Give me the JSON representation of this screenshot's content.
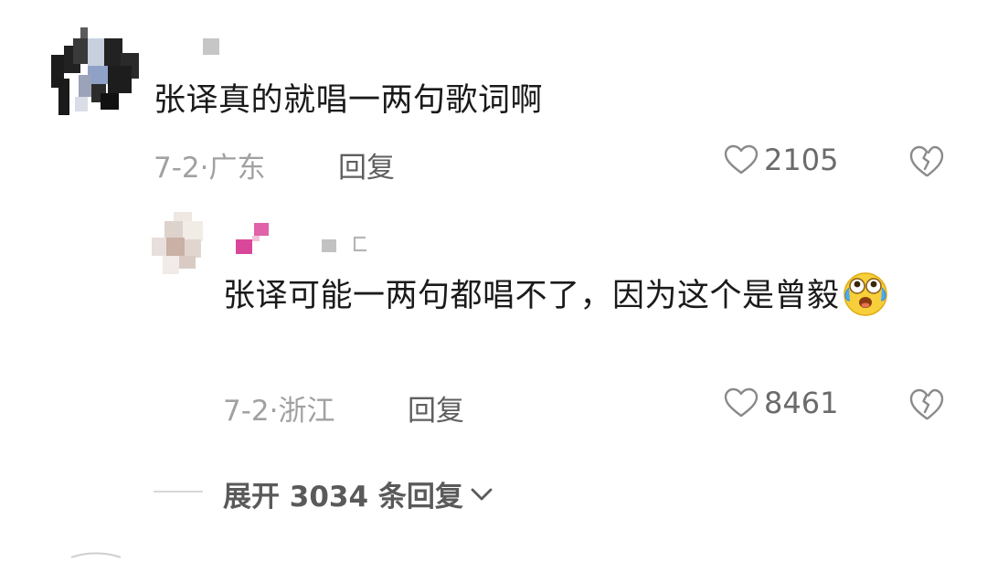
{
  "comment1": {
    "text": "张译真的就唱一两句歌词啊",
    "date": "7-2",
    "location": "广东",
    "reply_label": "回复",
    "likes": "2105",
    "avatar_icon": "avatar-pixelated-icon",
    "dislike_icon": "broken-heart-icon"
  },
  "comment2": {
    "text": "张译可能一两句都唱不了，因为这个是曾毅",
    "emoji": "crying-laughing-emoji",
    "date": "7-2",
    "location": "浙江",
    "reply_label": "回复",
    "likes": "8461",
    "avatar_icon": "avatar-pixelated-icon",
    "dislike_icon": "broken-heart-icon"
  },
  "expand": {
    "label": "展开 3034 条回复",
    "icon": "chevron-down-icon"
  },
  "colors": {
    "text": "#1a1a1a",
    "meta": "#a1a1a1",
    "reply": "#5f5f5f",
    "icon": "#8a8a8a"
  }
}
